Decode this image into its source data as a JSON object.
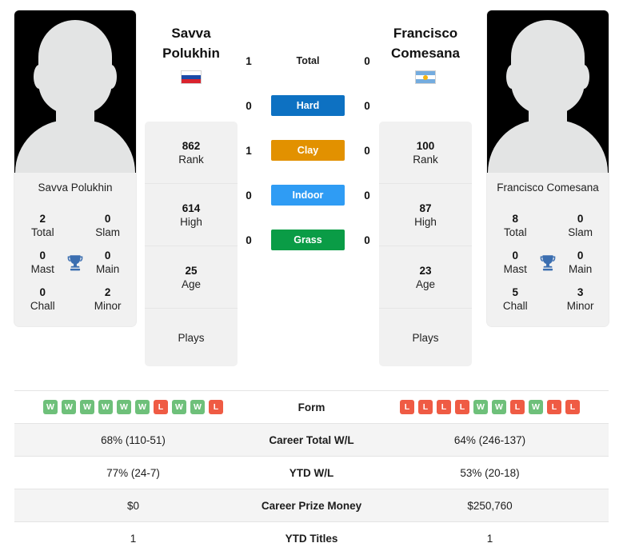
{
  "players": {
    "left": {
      "first_name": "Savva",
      "last_name": "Polukhin",
      "full_name": "Savva Polukhin",
      "country_code": "RU",
      "flag_icon": "flag-russia-icon",
      "rank": "862",
      "rank_label": "Rank",
      "high": "614",
      "high_label": "High",
      "age": "25",
      "age_label": "Age",
      "plays": "",
      "plays_label": "Plays",
      "titles": {
        "total": "2",
        "total_label": "Total",
        "slam": "0",
        "slam_label": "Slam",
        "mast": "0",
        "mast_label": "Mast",
        "main": "0",
        "main_label": "Main",
        "chall": "0",
        "chall_label": "Chall",
        "minor": "2",
        "minor_label": "Minor"
      },
      "form": [
        "W",
        "W",
        "W",
        "W",
        "W",
        "W",
        "L",
        "W",
        "W",
        "L"
      ],
      "career_total_wl": "68% (110-51)",
      "ytd_wl": "77% (24-7)",
      "career_prize_money": "$0",
      "ytd_titles": "1"
    },
    "right": {
      "first_name": "Francisco",
      "last_name": "Comesana",
      "full_name": "Francisco Comesana",
      "country_code": "AR",
      "flag_icon": "flag-argentina-icon",
      "rank": "100",
      "rank_label": "Rank",
      "high": "87",
      "high_label": "High",
      "age": "23",
      "age_label": "Age",
      "plays": "",
      "plays_label": "Plays",
      "titles": {
        "total": "8",
        "total_label": "Total",
        "slam": "0",
        "slam_label": "Slam",
        "mast": "0",
        "mast_label": "Mast",
        "main": "0",
        "main_label": "Main",
        "chall": "5",
        "chall_label": "Chall",
        "minor": "3",
        "minor_label": "Minor"
      },
      "form": [
        "L",
        "L",
        "L",
        "L",
        "W",
        "W",
        "L",
        "W",
        "L",
        "L"
      ],
      "career_total_wl": "64% (246-137)",
      "ytd_wl": "53% (20-18)",
      "career_prize_money": "$250,760",
      "ytd_titles": "1"
    }
  },
  "head_to_head": {
    "rows": [
      {
        "label": "Total",
        "left": "1",
        "right": "0",
        "color": "",
        "style": "plain"
      },
      {
        "label": "Hard",
        "left": "0",
        "right": "0",
        "color": "#0d71c2",
        "style": "badge"
      },
      {
        "label": "Clay",
        "left": "1",
        "right": "0",
        "color": "#e29100",
        "style": "badge"
      },
      {
        "label": "Indoor",
        "left": "0",
        "right": "0",
        "color": "#2f9cf4",
        "style": "badge"
      },
      {
        "label": "Grass",
        "left": "0",
        "right": "0",
        "color": "#0a9c46",
        "style": "badge"
      }
    ]
  },
  "comparison": {
    "rows": [
      {
        "label": "Form",
        "type": "form"
      },
      {
        "label": "Career Total W/L",
        "type": "text",
        "key": "career_total_wl"
      },
      {
        "label": "YTD W/L",
        "type": "text",
        "key": "ytd_wl"
      },
      {
        "label": "Career Prize Money",
        "type": "text",
        "key": "career_prize_money"
      },
      {
        "label": "YTD Titles",
        "type": "text",
        "key": "ytd_titles"
      }
    ]
  },
  "icons": {
    "trophy": "trophy-icon",
    "avatar_placeholder": "avatar-placeholder-icon"
  },
  "colors": {
    "win": "#6ec07a",
    "loss": "#ef5b44",
    "hard": "#0d71c2",
    "clay": "#e29100",
    "indoor": "#2f9cf4",
    "grass": "#0a9c46",
    "panel": "#f1f1f1"
  }
}
